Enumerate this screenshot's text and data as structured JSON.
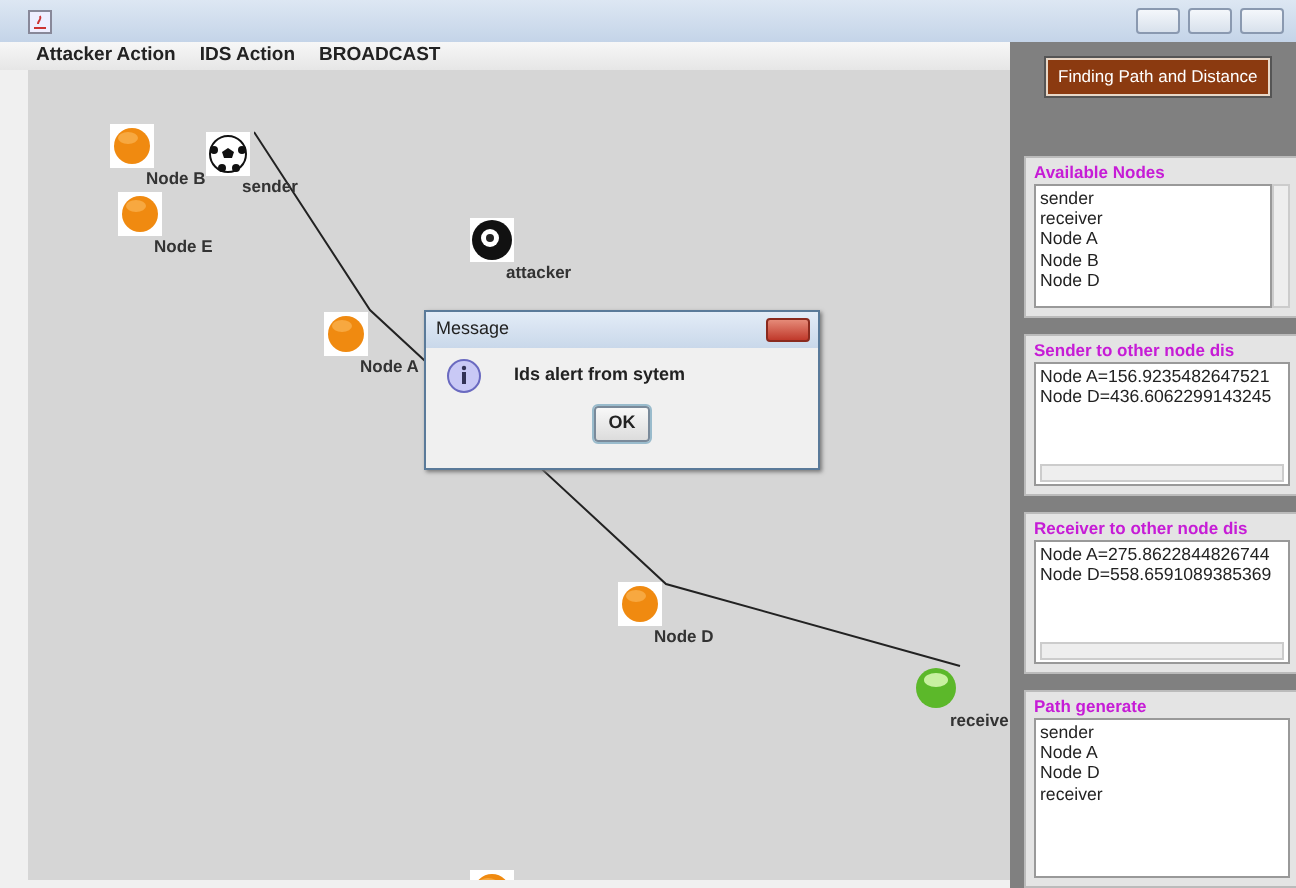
{
  "menu": [
    {
      "label": "Attacker Action"
    },
    {
      "label": "IDS Action"
    },
    {
      "label": "BROADCAST"
    }
  ],
  "canvas": {
    "nodes": [
      {
        "label": "Node B",
        "kind": "plain"
      },
      {
        "label": "sender",
        "kind": "sender"
      },
      {
        "label": "Node E",
        "kind": "plain"
      },
      {
        "label": "attacker",
        "kind": "attacker"
      },
      {
        "label": "Node A",
        "kind": "plain"
      },
      {
        "label": "Node D",
        "kind": "plain"
      },
      {
        "label": "receive",
        "kind": "receiver"
      },
      {
        "kind": "plain"
      }
    ]
  },
  "dialog": {
    "title": "Message",
    "message": "Ids alert from sytem",
    "button": "OK"
  },
  "side_panel": {
    "button": "Finding Path and Distance",
    "groups": [
      {
        "title": "Available Nodes",
        "kind": "list",
        "lines": [
          "sender",
          "receiver",
          "Node A",
          "Node B",
          "Node D"
        ]
      },
      {
        "title": "Sender to other node dis",
        "kind": "text",
        "lines": [
          "Node A=156.9235482647521",
          "Node D=436.6062299143245"
        ]
      },
      {
        "title": "Receiver to other node dis",
        "kind": "text",
        "lines": [
          "Node A=275.8622844826744",
          "Node D=558.6591089385369"
        ]
      },
      {
        "title": "Path generate",
        "kind": "plain",
        "lines": [
          "sender",
          "Node A",
          "Node D",
          "receiver"
        ]
      }
    ]
  }
}
